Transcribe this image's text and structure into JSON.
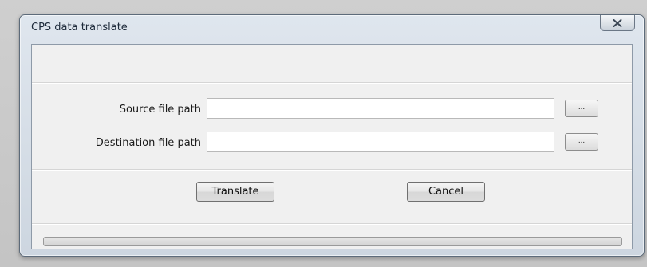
{
  "window": {
    "title": "CPS data translate",
    "close_icon": "close-icon"
  },
  "form": {
    "source_label": "Source file path",
    "source_value": "",
    "source_browse_label": "...",
    "destination_label": "Destination file path",
    "destination_value": "",
    "destination_browse_label": "..."
  },
  "actions": {
    "translate_label": "Translate",
    "cancel_label": "Cancel"
  },
  "progress": {
    "fraction": 0
  },
  "colors": {
    "frame": "#cdd6e0",
    "client_bg": "#f0f0f0",
    "progress_fill": "#37b42b"
  }
}
